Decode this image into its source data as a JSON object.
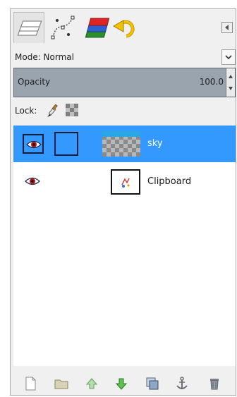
{
  "tabs": [
    {
      "icon": "layers-icon",
      "active": true
    },
    {
      "icon": "paths-icon",
      "active": false
    },
    {
      "icon": "channels-icon",
      "active": false
    },
    {
      "icon": "undo-history-icon",
      "active": false
    }
  ],
  "mode": {
    "label": "Mode: Normal"
  },
  "opacity": {
    "label": "Opacity",
    "value": "100.0"
  },
  "lock": {
    "label": "Lock:"
  },
  "layers": [
    {
      "name": "sky",
      "visible": true,
      "selected": true
    },
    {
      "name": "Clipboard",
      "visible": true,
      "selected": false
    }
  ],
  "colors": {
    "selection": "#3399ff",
    "opacity_bar": "#9aa4af"
  },
  "actions": [
    "new-layer-icon",
    "new-layer-group-icon",
    "raise-layer-icon",
    "lower-layer-icon",
    "duplicate-layer-icon",
    "anchor-layer-icon",
    "delete-layer-icon"
  ]
}
